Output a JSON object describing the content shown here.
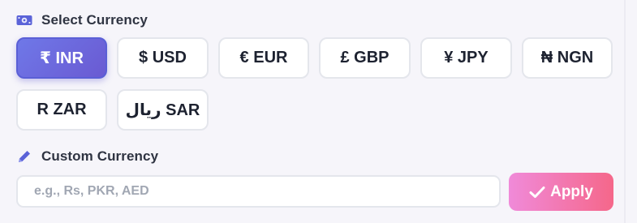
{
  "select_section": {
    "label": "Select Currency",
    "icon": "money-bill-icon",
    "icon_color": "#5b63d8"
  },
  "currencies": [
    {
      "code": "INR",
      "label": "₹ INR",
      "selected": true
    },
    {
      "code": "USD",
      "label": "$ USD",
      "selected": false
    },
    {
      "code": "EUR",
      "label": "€ EUR",
      "selected": false
    },
    {
      "code": "GBP",
      "label": "£ GBP",
      "selected": false
    },
    {
      "code": "JPY",
      "label": "¥ JPY",
      "selected": false
    },
    {
      "code": "NGN",
      "label": "₦ NGN",
      "selected": false
    },
    {
      "code": "ZAR",
      "label": "R ZAR",
      "selected": false
    },
    {
      "code": "SAR",
      "label": "ريال SAR",
      "selected": false
    }
  ],
  "custom_section": {
    "label": "Custom Currency",
    "icon": "pencil-icon",
    "icon_color": "#5b63d8",
    "input_value": "",
    "placeholder": "e.g., Rs, PKR, AED",
    "apply_label": "Apply",
    "apply_icon": "check-icon"
  },
  "colors": {
    "accent": "#6a5ad2",
    "apply_gradient_start": "#f08ad9",
    "apply_gradient_end": "#f5678a"
  }
}
